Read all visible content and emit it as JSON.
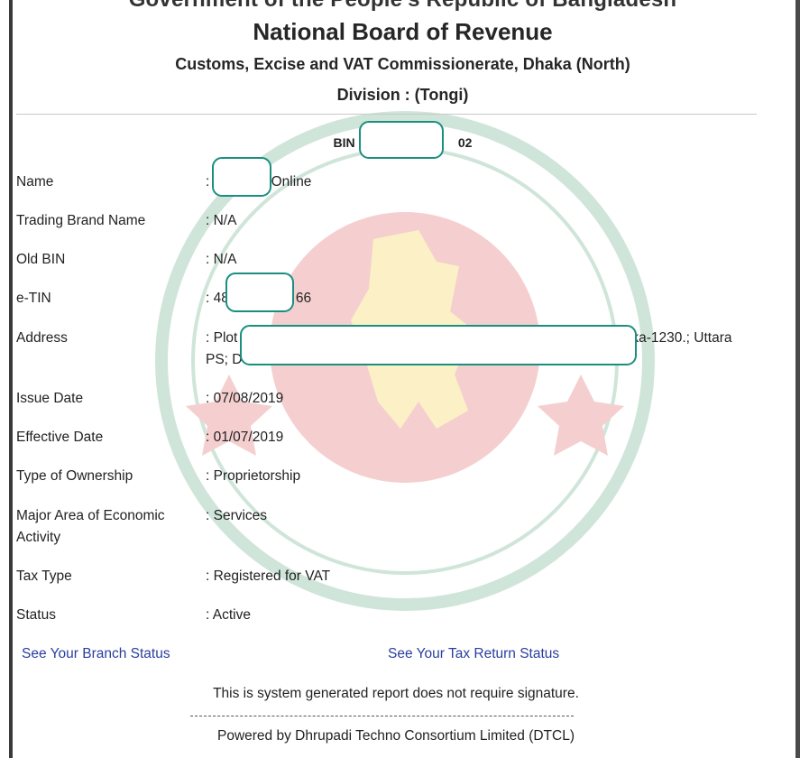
{
  "header": {
    "government": "Government of the People's Republic of Bangladesh",
    "board": "National Board of Revenue",
    "commissionerate": "Customs, Excise and VAT Commissionerate, Dhaka (North)",
    "division": "Division : (Tongi)"
  },
  "bin": {
    "label": "BIN : 0",
    "suffix": "02"
  },
  "fields": [
    {
      "label": "Name",
      "value": ": ",
      "value_tail": "Online"
    },
    {
      "label": "Trading Brand Name",
      "value": ": N/A"
    },
    {
      "label": "Old BIN",
      "value": ": N/A"
    },
    {
      "label": "e-TIN",
      "value": ": 48",
      "value_tail": "66"
    },
    {
      "label": "Address",
      "value": ": Plot",
      "value_tail": "ka-1230.; Uttara",
      "value_line2": "PS; D"
    },
    {
      "label": "Issue Date",
      "value": ": 07/08/2019"
    },
    {
      "label": "Effective Date",
      "value": ": 01/07/2019"
    },
    {
      "label": "Type of Ownership",
      "value": ": Proprietorship"
    },
    {
      "label": "Major Area of Economic",
      "label_line2": "Activity",
      "value": ": Services"
    },
    {
      "label": "Tax Type",
      "value": ": Registered for VAT"
    },
    {
      "label": "Status",
      "value": ": Active"
    }
  ],
  "links": {
    "branch_status": "See Your Branch Status",
    "tax_return_status": "See Your Tax Return Status"
  },
  "footer": {
    "note": "This is system generated report does not require signature.",
    "powered_by": "Powered by Dhrupadi Techno Consortium Limited (DTCL)"
  },
  "colors": {
    "redaction_border": "#1a8f80",
    "link": "#2a3f9e",
    "seal_green": "#2e8b57",
    "seal_red": "#d62828"
  }
}
